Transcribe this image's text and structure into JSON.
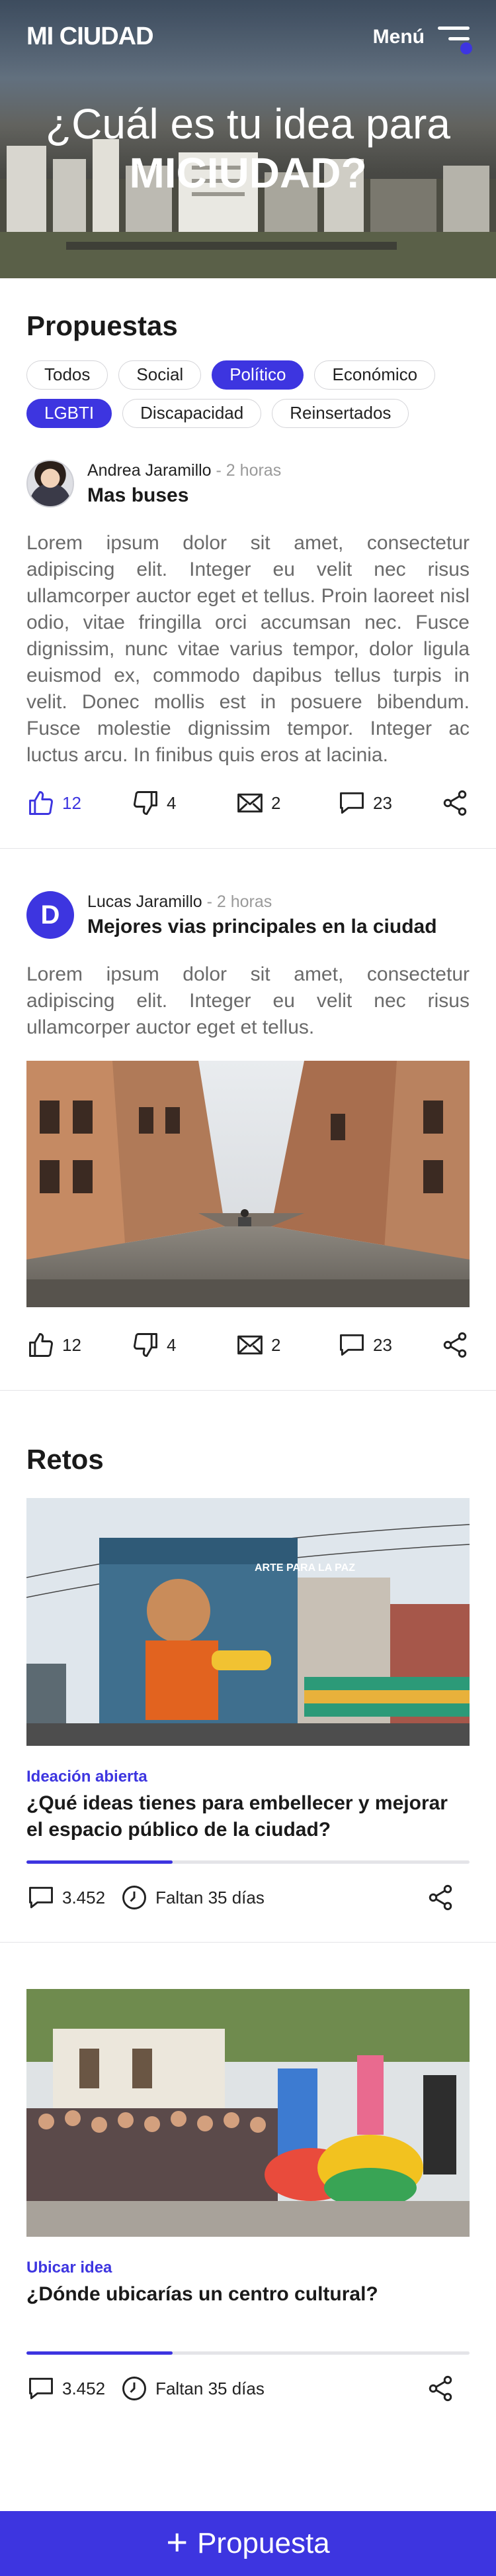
{
  "header": {
    "brand": "MI CIUDAD",
    "menu_label": "Menú",
    "hero_line1": "¿Cuál es tu idea para",
    "hero_line2": "MICIUDAD?"
  },
  "propuestas": {
    "title": "Propuestas",
    "filters": [
      {
        "label": "Todos",
        "active": false
      },
      {
        "label": "Social",
        "active": false
      },
      {
        "label": "Político",
        "active": true
      },
      {
        "label": "Económico",
        "active": false
      },
      {
        "label": "LGBTI",
        "active": true
      },
      {
        "label": "Discapacidad",
        "active": false
      },
      {
        "label": "Reinsertados",
        "active": false
      }
    ],
    "posts": [
      {
        "author": "Andrea Jaramillo",
        "time": " - 2 horas",
        "title": "Mas buses",
        "body": "Lorem ipsum dolor sit amet, consectetur adipiscing elit. Integer eu velit nec risus ullamcorper auctor eget et tellus. Proin laoreet nisl odio, vitae fringilla orci accumsan nec. Fusce dignissim, nunc vitae varius tempor, dolor ligula euismod ex, commodo dapibus tellus turpis in velit. Donec mollis est in posuere bibendum. Fusce molestie dignissim tempor. Integer ac luctus arcu. In finibus quis eros at lacinia.",
        "likes": "12",
        "dislikes": "4",
        "messages": "2",
        "comments": "23"
      },
      {
        "avatar_letter": "D",
        "author": "Lucas Jaramillo",
        "time": " - 2 horas",
        "title": "Mejores vias principales en la ciudad",
        "body": "Lorem ipsum dolor sit amet, consectetur adipiscing elit. Integer eu velit nec risus ullamcorper auctor eget et tellus.",
        "likes": "12",
        "dislikes": "4",
        "messages": "2",
        "comments": "23"
      }
    ]
  },
  "retos": {
    "title": "Retos",
    "items": [
      {
        "tag": "Ideación abierta",
        "title": "¿Qué ideas tienes para embellecer y mejorar el espacio público de la ciudad?",
        "comments": "3.452",
        "remaining": "Faltan 35 días",
        "progress": 0.33,
        "mural_text": "ARTE PARA LA PAZ"
      },
      {
        "tag": "Ubicar idea",
        "title": "¿Dónde ubicarías un centro cultural?",
        "comments": "3.452",
        "remaining": "Faltan 35 días",
        "progress": 0.33
      }
    ]
  },
  "cta": {
    "label": "Propuesta"
  },
  "colors": {
    "accent": "#3d35e0"
  }
}
